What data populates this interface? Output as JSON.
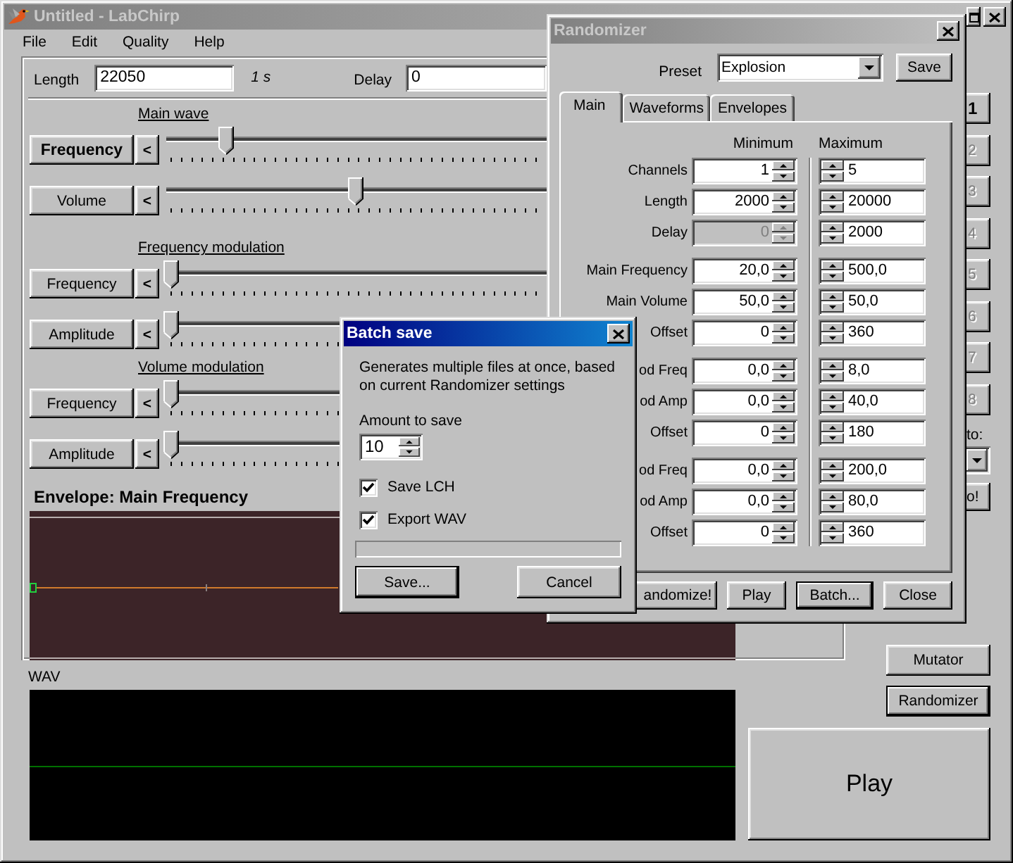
{
  "main_window": {
    "title": "Untitled - LabChirp",
    "active": false,
    "menu": [
      "File",
      "Edit",
      "Quality",
      "Help"
    ],
    "length": {
      "label": "Length",
      "value": "22050",
      "duration": "1 s"
    },
    "delay": {
      "label": "Delay",
      "value": "0"
    },
    "sections": [
      {
        "title": "Main wave",
        "rows": [
          {
            "label": "Frequency",
            "selected": true,
            "left_button": "<",
            "level": 0.15
          },
          {
            "label": "Volume",
            "selected": false,
            "left_button": "<",
            "level": 0.5
          }
        ]
      },
      {
        "title": "Frequency modulation",
        "rows": [
          {
            "label": "Frequency",
            "selected": false,
            "left_button": "<",
            "level": 0
          },
          {
            "label": "Amplitude",
            "selected": false,
            "left_button": "<",
            "level": 0
          }
        ]
      },
      {
        "title": "Volume modulation",
        "rows": [
          {
            "label": "Frequency",
            "selected": false,
            "left_button": "<",
            "level": 0
          },
          {
            "label": "Amplitude",
            "selected": false,
            "left_button": "<",
            "level": 0
          }
        ]
      }
    ],
    "envelope": {
      "title": "Envelope: Main Frequency"
    },
    "channels": {
      "buttons": [
        {
          "label": "1",
          "selected": true,
          "disabled": false
        },
        {
          "label": "2",
          "selected": false,
          "disabled": true
        },
        {
          "label": "3",
          "selected": false,
          "disabled": true
        },
        {
          "label": "4",
          "selected": false,
          "disabled": true
        },
        {
          "label": "5",
          "selected": false,
          "disabled": true
        },
        {
          "label": "6",
          "selected": false,
          "disabled": true
        },
        {
          "label": "7",
          "selected": false,
          "disabled": true
        },
        {
          "label": "8",
          "selected": false,
          "disabled": true
        }
      ],
      "target_label": "to:",
      "go_button": "o!"
    },
    "side_buttons": [
      {
        "label": "Mutator",
        "default": false
      },
      {
        "label": "Randomizer",
        "default": true
      }
    ],
    "wav": {
      "title": "WAV"
    },
    "play_button": "Play"
  },
  "randomizer": {
    "title": "Randomizer",
    "active": false,
    "preset_label": "Preset",
    "preset": "Explosion",
    "save_button": "Save",
    "tabs": [
      {
        "label": "Main",
        "selected": true
      },
      {
        "label": "Waveforms",
        "selected": false
      },
      {
        "label": "Envelopes",
        "selected": false
      }
    ],
    "columns": [
      "Minimum",
      "Maximum"
    ],
    "groups": [
      {
        "rows": [
          {
            "label": "Channels",
            "min": {
              "value": "1",
              "disabled": false
            },
            "max": "5"
          },
          {
            "label": "Length",
            "min": {
              "value": "2000",
              "disabled": false
            },
            "max": "20000"
          },
          {
            "label": "Delay",
            "min": {
              "value": "0",
              "disabled": true
            },
            "max": "2000"
          }
        ]
      },
      {
        "rows": [
          {
            "label": "Main Frequency",
            "min": {
              "value": "20,0",
              "disabled": false
            },
            "max": "500,0"
          },
          {
            "label": "Main Volume",
            "min": {
              "value": "50,0",
              "disabled": false
            },
            "max": "50,0"
          },
          {
            "label": "Offset",
            "min": {
              "value": "0",
              "disabled": false
            },
            "max": "360"
          }
        ]
      },
      {
        "rows": [
          {
            "label": "od Freq",
            "min": {
              "value": "0,0",
              "disabled": false
            },
            "max": "8,0"
          },
          {
            "label": "od Amp",
            "min": {
              "value": "0,0",
              "disabled": false
            },
            "max": "40,0"
          },
          {
            "label": "Offset",
            "min": {
              "value": "0",
              "disabled": false
            },
            "max": "180"
          }
        ]
      },
      {
        "rows": [
          {
            "label": "od Freq",
            "min": {
              "value": "0,0",
              "disabled": false
            },
            "max": "200,0"
          },
          {
            "label": "od Amp",
            "min": {
              "value": "0,0",
              "disabled": false
            },
            "max": "80,0"
          },
          {
            "label": "Offset",
            "min": {
              "value": "0",
              "disabled": false
            },
            "max": "360"
          }
        ]
      }
    ],
    "buttons": [
      {
        "label": "andomize!",
        "default": false
      },
      {
        "label": "Play",
        "default": false
      },
      {
        "label": "Batch...",
        "default": true
      },
      {
        "label": "Close",
        "default": false
      }
    ]
  },
  "batch_save": {
    "title": "Batch save",
    "active": true,
    "description": "Generates multiple files at once, based on current Randomizer settings",
    "amount_label": "Amount to save",
    "amount": "10",
    "checkboxes": [
      {
        "label": "Save LCH",
        "checked": true
      },
      {
        "label": "Export WAV",
        "checked": true
      }
    ],
    "progress": {
      "level": 0
    },
    "buttons": [
      {
        "label": "Save...",
        "default": true
      },
      {
        "label": "Cancel",
        "default": false
      }
    ]
  }
}
